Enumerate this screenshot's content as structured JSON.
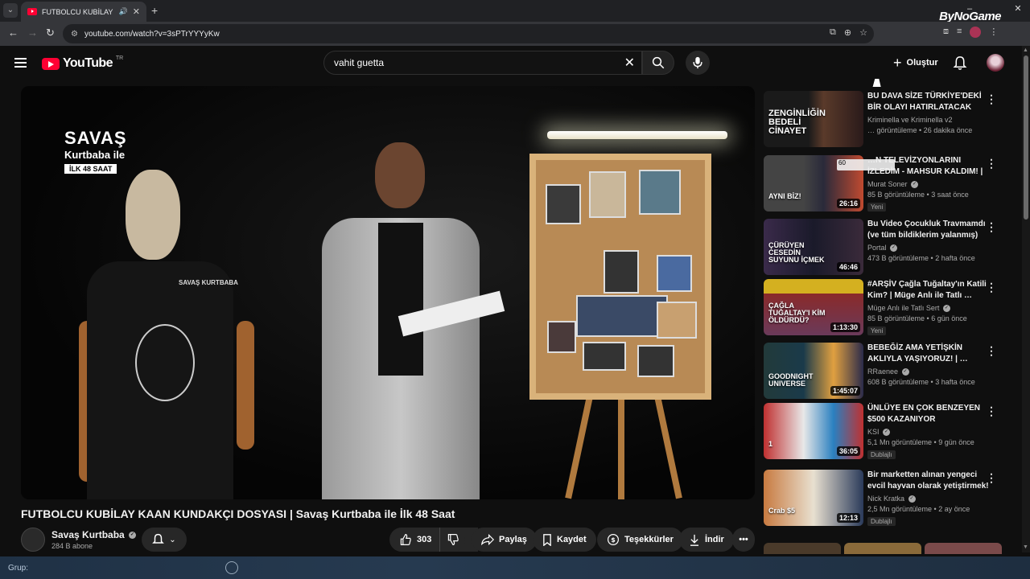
{
  "browser": {
    "tab_title": "FUTBOLCU KUBİLAY KAAN",
    "url": "youtube.com/watch?v=3sPTrYYYyKw",
    "watermark": "ByNoGame"
  },
  "header": {
    "logo_text": "YouTube",
    "country_code": "TR",
    "search_value": "vahit guetta",
    "create_label": "Oluştur"
  },
  "video": {
    "title": "FUTBOLCU KUBİLAY KAAN KUNDAKÇI DOSYASI | Savaş Kurtbaba ile İlk 48 Saat",
    "channel": "Savaş Kurtbaba",
    "subscribers": "284 B abone",
    "likes": "303",
    "share_label": "Paylaş",
    "save_label": "Kaydet",
    "thanks_label": "Teşekkürler",
    "download_label": "İndir",
    "logo_line1": "SAVAŞ",
    "logo_line2": "Kurtbaba ile",
    "logo_line3": "İLK 48 SAAT",
    "shirt_logo": "SAVAŞ KURTBABA"
  },
  "recommendations": [
    {
      "title": "BU DAVA SİZE TÜRKİYE'DEKİ BİR OLAYI HATIRLATACAK",
      "channel": "Kriminella ve Kriminella v2",
      "meta": "… görüntüleme • 26 dakika önce",
      "duration": "",
      "badge": "",
      "verified": false,
      "thumb_text": "ZENGİNLİĞİN BEDELİ CİNAYET"
    },
    {
      "title": "…N TELEVİZYONLARINI İZLEDİM - MAHSUR KALDIM! | …",
      "channel": "Murat Soner",
      "meta": "85 B görüntüleme • 3 saat önce",
      "duration": "26:16",
      "badge": "Yeni",
      "verified": true,
      "thumb_text": "AYNI BİZ!"
    },
    {
      "title": "Bu Video Çocukluk Travmamdı (ve tüm bildiklerim yalanmış)",
      "channel": "Portal",
      "meta": "473 B görüntüleme • 2 hafta önce",
      "duration": "46:46",
      "badge": "",
      "verified": true,
      "thumb_text": "ÇÜRÜYEN CESEDİN SUYUNU İÇMEK"
    },
    {
      "title": "#ARŞİV Çağla Tuğaltay'ın Katili Kim? | Müge Anlı ile Tatlı …",
      "channel": "Müge Anlı ile Tatlı Sert",
      "meta": "85 B görüntüleme • 6 gün önce",
      "duration": "1:13:30",
      "badge": "Yeni",
      "verified": true,
      "thumb_text": "ÇAĞLA TUĞALTAY'I KİM ÖLDÜRDÜ?"
    },
    {
      "title": "BEBEĞİZ AMA YETİŞKİN AKLIYLA YAŞIYORUZ! | …",
      "channel": "RRaenee",
      "meta": "608 B görüntüleme • 3 hafta önce",
      "duration": "1:45:07",
      "badge": "",
      "verified": true,
      "thumb_text": "GOODNIGHT UNIVERSE"
    },
    {
      "title": "ÜNLÜYE EN ÇOK BENZEYEN $500 KAZANIYOR",
      "channel": "KSI",
      "meta": "5,1 Mn görüntüleme • 9 gün önce",
      "duration": "36:05",
      "badge": "Dublajlı",
      "verified": true,
      "thumb_text": "1"
    },
    {
      "title": "Bir marketten alınan yengeci evcil hayvan olarak yetiştirmek!",
      "channel": "Nick Kratka",
      "meta": "2,5 Mn görüntüleme • 2 ay önce",
      "duration": "12:13",
      "badge": "Dublajlı",
      "verified": true,
      "thumb_text": "Crab $5"
    }
  ],
  "overlay_badge": "60",
  "taskbar": {
    "label": "Grup:"
  },
  "colors": {
    "brand": "#ff0033",
    "bg": "#0f0f0f"
  }
}
